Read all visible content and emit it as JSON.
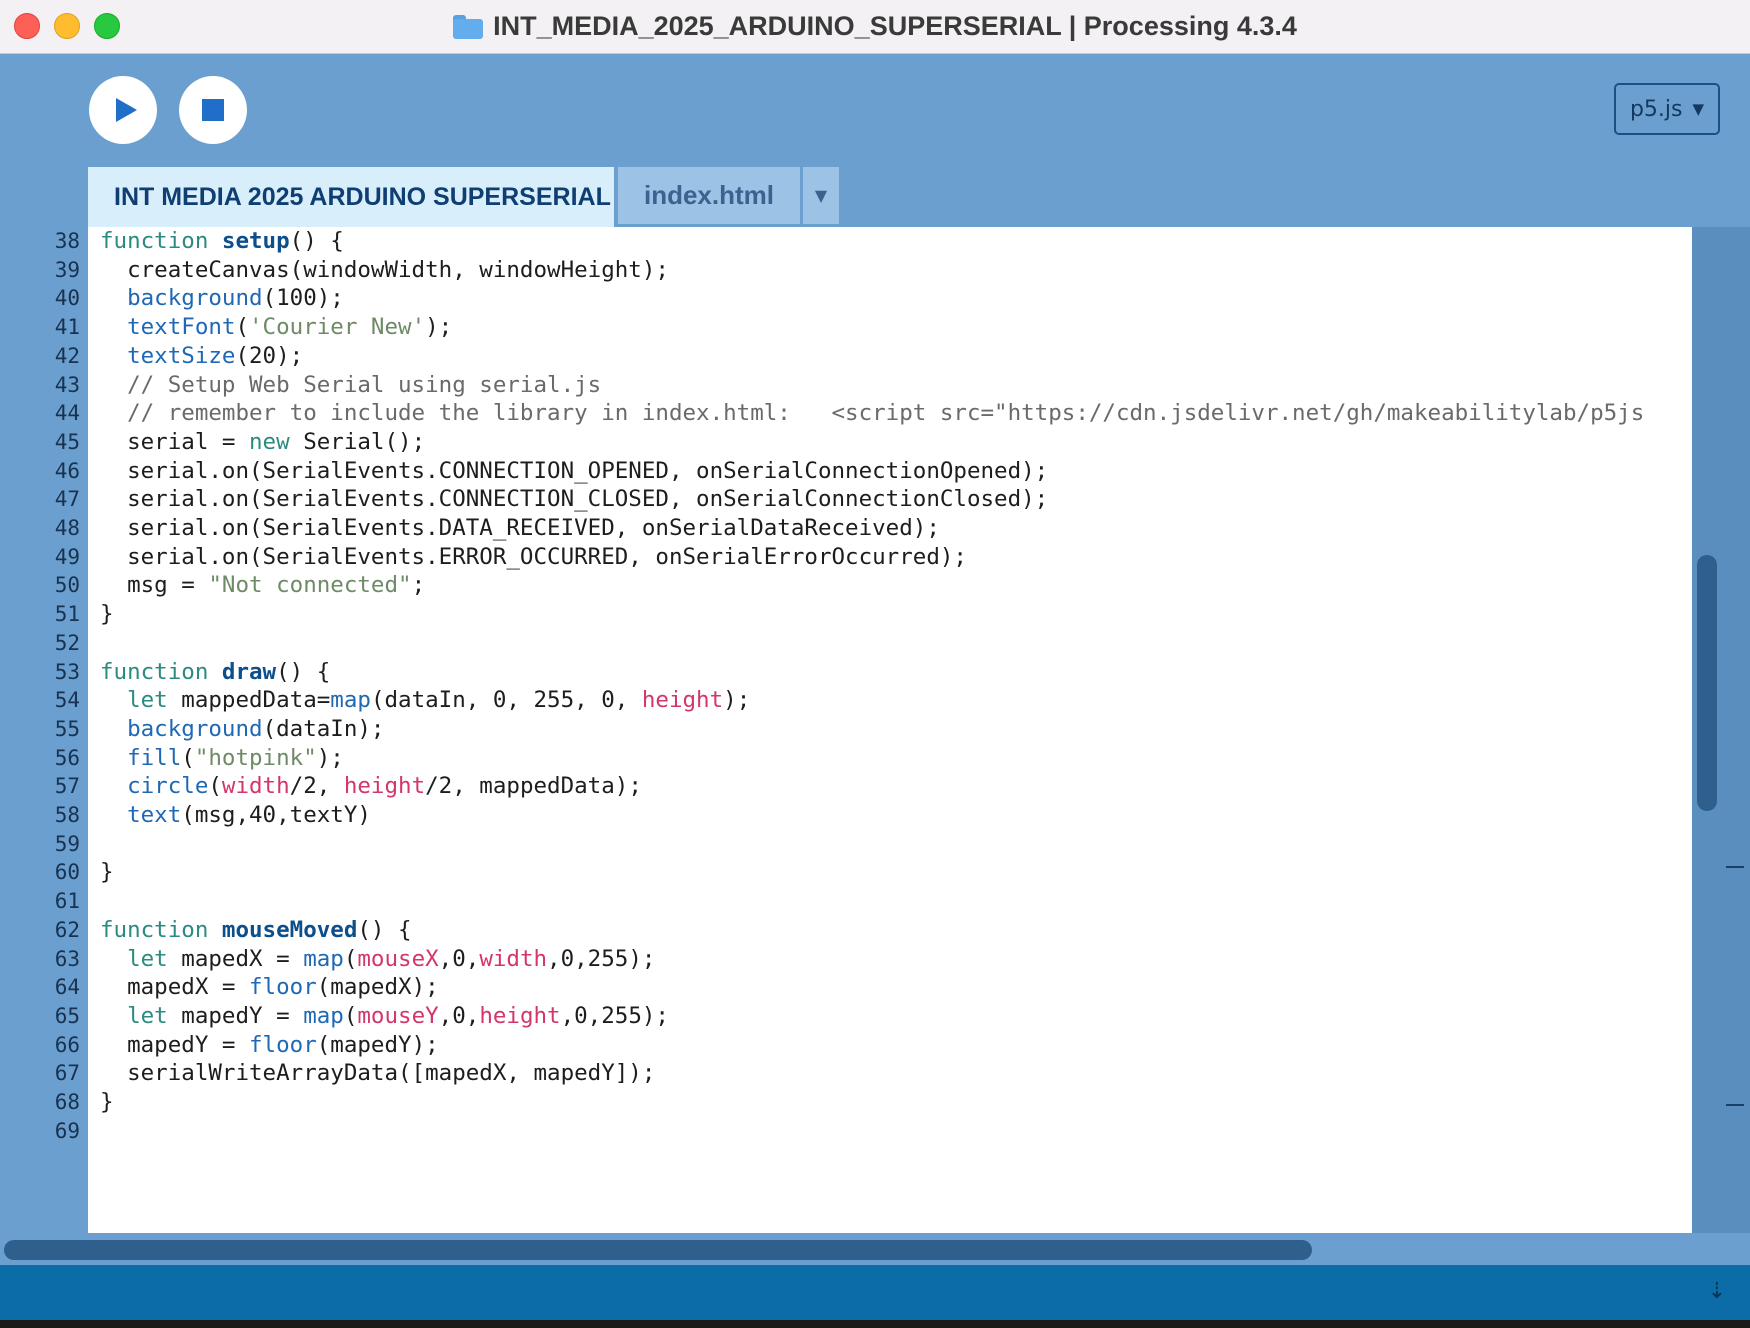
{
  "window": {
    "title": "INT_MEDIA_2025_ARDUINO_SUPERSERIAL | Processing 4.3.4",
    "icon": "folder-icon"
  },
  "toolbar": {
    "run_icon": "play-icon",
    "stop_icon": "stop-icon",
    "mode": "p5.js",
    "mode_caret": "▼"
  },
  "tabs": [
    {
      "label": "INT MEDIA 2025 ARDUINO SUPERSERIAL",
      "active": true
    },
    {
      "label": "index.html",
      "active": false
    }
  ],
  "tab_menu_caret": "▼",
  "colors": {
    "frame": "#6b9fcf",
    "active_tab": "#d9eefb",
    "inactive_tab": "#9cc2e5",
    "status_bar": "#0b6ca8",
    "keyword": "#2b8b80",
    "function_name": "#0d4e8c",
    "builtin": "#1e68b5",
    "string": "#6e8a66",
    "comment": "#6a6a6a",
    "variable": "#d3366a"
  },
  "code": [
    {
      "n": "38",
      "seg": [
        [
          "k",
          "function"
        ],
        [
          "t",
          " "
        ],
        [
          "kb",
          "setup"
        ],
        [
          "t",
          "() {"
        ]
      ]
    },
    {
      "n": "39",
      "seg": [
        [
          "t",
          "  createCanvas(windowWidth, windowHeight);"
        ]
      ]
    },
    {
      "n": "40",
      "seg": [
        [
          "t",
          "  "
        ],
        [
          "f",
          "background"
        ],
        [
          "t",
          "(100);"
        ]
      ]
    },
    {
      "n": "41",
      "seg": [
        [
          "t",
          "  "
        ],
        [
          "f",
          "textFont"
        ],
        [
          "t",
          "("
        ],
        [
          "s",
          "'Courier New'"
        ],
        [
          "t",
          ");"
        ]
      ]
    },
    {
      "n": "42",
      "seg": [
        [
          "t",
          "  "
        ],
        [
          "f",
          "textSize"
        ],
        [
          "t",
          "(20);"
        ]
      ]
    },
    {
      "n": "43",
      "seg": [
        [
          "c",
          "  // Setup Web Serial using serial.js"
        ]
      ]
    },
    {
      "n": "44",
      "seg": [
        [
          "c",
          "  // remember to include the library in index.html:   <script src=\"https://cdn.jsdelivr.net/gh/makeabilitylab/p5js"
        ]
      ]
    },
    {
      "n": "45",
      "seg": [
        [
          "t",
          "  serial = "
        ],
        [
          "k",
          "new"
        ],
        [
          "t",
          " Serial();"
        ]
      ]
    },
    {
      "n": "46",
      "seg": [
        [
          "t",
          "  serial.on(SerialEvents.CONNECTION_OPENED, onSerialConnectionOpened);"
        ]
      ]
    },
    {
      "n": "47",
      "seg": [
        [
          "t",
          "  serial.on(SerialEvents.CONNECTION_CLOSED, onSerialConnectionClosed);"
        ]
      ]
    },
    {
      "n": "48",
      "seg": [
        [
          "t",
          "  serial.on(SerialEvents.DATA_RECEIVED, onSerialDataReceived);"
        ]
      ]
    },
    {
      "n": "49",
      "seg": [
        [
          "t",
          "  serial.on(SerialEvents.ERROR_OCCURRED, onSerialErrorOccurred);"
        ]
      ]
    },
    {
      "n": "50",
      "seg": [
        [
          "t",
          "  msg = "
        ],
        [
          "s",
          "\"Not connected\""
        ],
        [
          "t",
          ";"
        ]
      ]
    },
    {
      "n": "51",
      "seg": [
        [
          "t",
          "}"
        ]
      ]
    },
    {
      "n": "52",
      "seg": []
    },
    {
      "n": "53",
      "seg": [
        [
          "k",
          "function"
        ],
        [
          "t",
          " "
        ],
        [
          "kb",
          "draw"
        ],
        [
          "t",
          "() {"
        ]
      ]
    },
    {
      "n": "54",
      "seg": [
        [
          "t",
          "  "
        ],
        [
          "k",
          "let"
        ],
        [
          "t",
          " mappedData="
        ],
        [
          "f",
          "map"
        ],
        [
          "t",
          "(dataIn, 0, 255, 0, "
        ],
        [
          "v",
          "height"
        ],
        [
          "t",
          ");"
        ]
      ]
    },
    {
      "n": "55",
      "seg": [
        [
          "t",
          "  "
        ],
        [
          "f",
          "background"
        ],
        [
          "t",
          "(dataIn);"
        ]
      ]
    },
    {
      "n": "56",
      "seg": [
        [
          "t",
          "  "
        ],
        [
          "f",
          "fill"
        ],
        [
          "t",
          "("
        ],
        [
          "s",
          "\"hotpink\""
        ],
        [
          "t",
          ");"
        ]
      ]
    },
    {
      "n": "57",
      "seg": [
        [
          "t",
          "  "
        ],
        [
          "f",
          "circle"
        ],
        [
          "t",
          "("
        ],
        [
          "v",
          "width"
        ],
        [
          "t",
          "/2, "
        ],
        [
          "v",
          "height"
        ],
        [
          "t",
          "/2, mappedData);"
        ]
      ]
    },
    {
      "n": "58",
      "seg": [
        [
          "t",
          "  "
        ],
        [
          "f",
          "text"
        ],
        [
          "t",
          "(msg,40,textY)"
        ]
      ]
    },
    {
      "n": "59",
      "seg": []
    },
    {
      "n": "60",
      "seg": [
        [
          "t",
          "}"
        ]
      ]
    },
    {
      "n": "61",
      "seg": []
    },
    {
      "n": "62",
      "seg": [
        [
          "k",
          "function"
        ],
        [
          "t",
          " "
        ],
        [
          "kb",
          "mouseMoved"
        ],
        [
          "t",
          "() {"
        ]
      ]
    },
    {
      "n": "63",
      "seg": [
        [
          "t",
          "  "
        ],
        [
          "k",
          "let"
        ],
        [
          "t",
          " mapedX = "
        ],
        [
          "f",
          "map"
        ],
        [
          "t",
          "("
        ],
        [
          "v",
          "mouseX"
        ],
        [
          "t",
          ",0,"
        ],
        [
          "v",
          "width"
        ],
        [
          "t",
          ",0,255);"
        ]
      ]
    },
    {
      "n": "64",
      "seg": [
        [
          "t",
          "  mapedX = "
        ],
        [
          "f",
          "floor"
        ],
        [
          "t",
          "(mapedX);"
        ]
      ]
    },
    {
      "n": "65",
      "seg": [
        [
          "t",
          "  "
        ],
        [
          "k",
          "let"
        ],
        [
          "t",
          " mapedY = "
        ],
        [
          "f",
          "map"
        ],
        [
          "t",
          "("
        ],
        [
          "v",
          "mouseY"
        ],
        [
          "t",
          ",0,"
        ],
        [
          "v",
          "height"
        ],
        [
          "t",
          ",0,255);"
        ]
      ]
    },
    {
      "n": "66",
      "seg": [
        [
          "t",
          "  mapedY = "
        ],
        [
          "f",
          "floor"
        ],
        [
          "t",
          "(mapedY);"
        ]
      ]
    },
    {
      "n": "67",
      "seg": [
        [
          "t",
          "  serialWriteArrayData([mapedX, mapedY]);"
        ]
      ]
    },
    {
      "n": "68",
      "seg": [
        [
          "t",
          "}"
        ]
      ]
    },
    {
      "n": "69",
      "seg": []
    }
  ],
  "status": {
    "console_toggle": "⇣",
    "console_icon": "console-toggle-icon"
  }
}
